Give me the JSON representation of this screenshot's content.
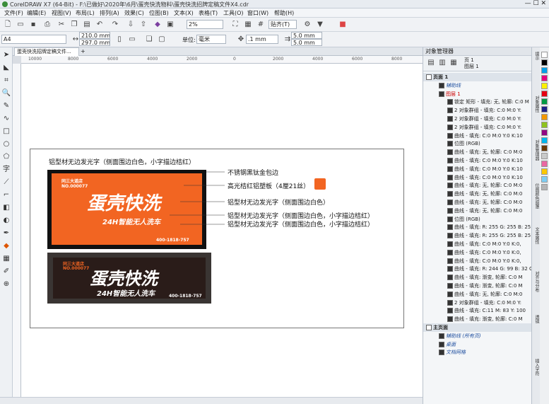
{
  "window": {
    "title": "CorelDRAW X7 (64-Bit) - F:\\已做好\\2020年\\6月\\蛋壳快洗物料\\蛋壳快洗招牌定稿文件X4.cdr"
  },
  "menu": [
    "文件(F)",
    "编辑(E)",
    "视图(V)",
    "布局(L)",
    "排列(A)",
    "效果(C)",
    "位图(B)",
    "文本(X)",
    "表格(T)",
    "工具(O)",
    "窗口(W)",
    "帮助(H)"
  ],
  "toolbar": {
    "zoom": "2%",
    "snap": "贴齐(T)"
  },
  "propbar": {
    "page_size": "A4",
    "width": "210.0 mm",
    "height": "297.0 mm",
    "units_label": "单位:",
    "units": "毫米",
    "nudge": ".1 mm",
    "dup_x": "5.0 mm",
    "dup_y": "5.0 mm"
  },
  "doc_tab": "蛋壳快洗招牌定稿文件...",
  "ruler_ticks": [
    "10000",
    "8000",
    "6000",
    "4000",
    "2000",
    "0",
    "2000",
    "4000",
    "6000",
    "8000"
  ],
  "design": {
    "title_note": "铝型材无边发光字（侧面围边白色，小字描边桔红）",
    "sign1": {
      "store": "同三大道店",
      "no": "NO.000077",
      "brand": "蛋壳快洗",
      "sub": "24H智能无人洗车",
      "phone": "400-1818-757"
    },
    "sign2": {
      "store": "同三大道店",
      "no": "NO.000077",
      "brand": "蛋壳快洗",
      "sub": "24H智能无人洗车",
      "phone": "400-1818-757"
    },
    "annotations": [
      "不锈钢黑钛金包边",
      "高光桔红铝塑板（4厘21丝）",
      "铝型材无边发光字（侧面围边白色）",
      "铝型材无边发光字（侧面围边白色，小字描边桔红）",
      "铝型材无边发光字（侧面围边白色，小字描边桔红）"
    ],
    "accent": "#f26522"
  },
  "object_manager": {
    "title": "对象管理器",
    "page_label": "页 1",
    "layer_label": "图层 1",
    "rows": [
      "页面 1",
      "辅助线",
      "图层 1",
      "锁定 矩形 - 填充: 无, 轮廓: C:0 M",
      "2 对象群组 - 填充: C:0 M:0 Y:",
      "2 对象群组 - 填充: C:0 M:0 Y:",
      "2 对象群组 - 填充: C:0 M:0 Y:",
      "曲线 - 填充: C:0 M:0 Y:0 K:10",
      "位图 (RGB)",
      "曲线 - 填充: 无, 轮廓: C:0 M:0",
      "曲线 - 填充: C:0 M:0 Y:0 K:10",
      "曲线 - 填充: C:0 M:0 Y:0 K:10",
      "曲线 - 填充: C:0 M:0 Y:0 K:10",
      "曲线 - 填充: 无, 轮廓: C:0 M:0",
      "曲线 - 填充: 无, 轮廓: C:0 M:0",
      "曲线 - 填充: 无, 轮廓: C:0 M:0",
      "曲线 - 填充: 无, 轮廓: C:0 M:0",
      "位图 (RGB)",
      "曲线 - 填充: R: 255 G: 255 B: 25",
      "曲线 - 填充: R: 255 G: 255 B: 25",
      "曲线 - 填充: C:0 M:0 Y:0 K:0,",
      "曲线 - 填充: C:0 M:0 Y:0 K:0,",
      "曲线 - 填充: C:0 M:0 Y:0 K:0,",
      "曲线 - 填充: R: 244 G: 99 B: 32 C",
      "曲线 - 填充: 渐变, 轮廓: C:0 M",
      "曲线 - 填充: 渐变, 轮廓: C:0 M",
      "曲线 - 填充: 无, 轮廓: C:0 M:0",
      "2 对象群组 - 填充: C:0 M:0 Y:",
      "曲线 - 填充: C:11 M: 83 Y: 100",
      "曲线 - 填充: 渐变, 轮廓: C:0 M",
      "主页面",
      "辅助线 (所有页)",
      "桌面",
      "文档网格"
    ]
  },
  "dock_tabs": [
    "提示",
    "对象属性",
    "对象管理器",
    "位图颜色遮罩",
    "文本属性",
    "对齐与分布",
    "透镜",
    "插入字符"
  ],
  "palette": [
    "#ffffff",
    "#000000",
    "#00a0e9",
    "#e4007f",
    "#fff100",
    "#e60012",
    "#009944",
    "#1d2088",
    "#f39800",
    "#8fc31f",
    "#920783",
    "#00b7ee",
    "#6a3906",
    "#c9caca",
    "#ea68a2",
    "#fcc800",
    "#7ecef4",
    "#b5b5b6"
  ]
}
